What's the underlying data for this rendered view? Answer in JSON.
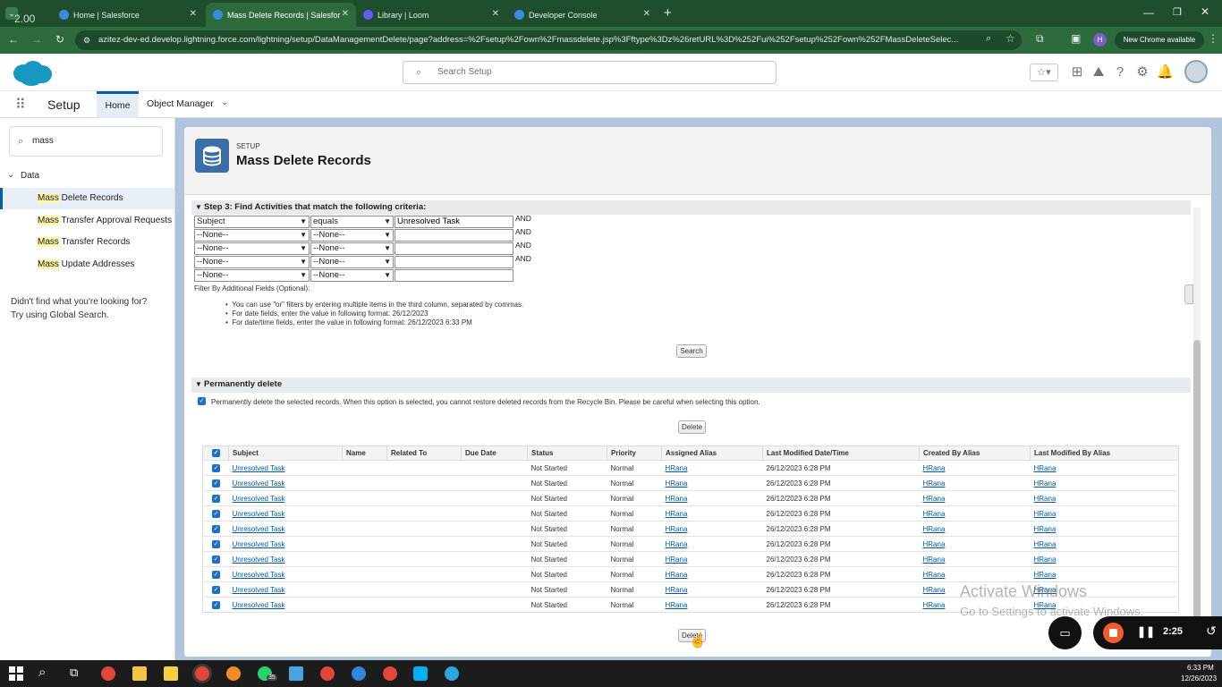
{
  "browser": {
    "overlay_text": "2.00",
    "tabs": [
      {
        "title": "Home | Salesforce",
        "color": "#3a8be0"
      },
      {
        "title": "Mass Delete Records | Salesfor",
        "color": "#3a8be0"
      },
      {
        "title": "Library | Loom",
        "color": "#625df5"
      },
      {
        "title": "Developer Console",
        "color": "#3a8be0"
      }
    ],
    "new_tab": "+",
    "url": "azitez-dev-ed.develop.lightning.force.com/lightning/setup/DataManagementDelete/page?address=%2Fsetup%2Fown%2Fmassdelete.jsp%3Fftype%3Dz%26retURL%3D%252Fui%252Fsetup%252Fown%252FMassDeleteSelec...",
    "profile_initial": "H",
    "update_label": "New Chrome available"
  },
  "sf_header": {
    "search_placeholder": "Search Setup"
  },
  "setup_nav": {
    "app_label": "Setup",
    "tabs": [
      "Home",
      "Object Manager"
    ]
  },
  "sidebar": {
    "search_value": "mass",
    "group": "Data",
    "items": [
      {
        "highlight": "Mass",
        "rest": " Delete Records"
      },
      {
        "highlight": "Mass",
        "rest": " Transfer Approval Requests"
      },
      {
        "highlight": "Mass",
        "rest": " Transfer Records"
      },
      {
        "highlight": "Mass",
        "rest": " Update Addresses"
      }
    ],
    "not_found_1": "Didn't find what you're looking for?",
    "not_found_2": "Try using Global Search."
  },
  "page": {
    "eyebrow": "SETUP",
    "title": "Mass Delete Records"
  },
  "step3": {
    "heading": "Step 3: Find Activities that match the following criteria:",
    "rows": [
      {
        "field": "Subject",
        "operator": "equals",
        "value": "Unresolved Task",
        "conj": "AND"
      },
      {
        "field": "--None--",
        "operator": "--None--",
        "value": "",
        "conj": "AND"
      },
      {
        "field": "--None--",
        "operator": "--None--",
        "value": "",
        "conj": "AND"
      },
      {
        "field": "--None--",
        "operator": "--None--",
        "value": "",
        "conj": "AND"
      },
      {
        "field": "--None--",
        "operator": "--None--",
        "value": "",
        "conj": ""
      }
    ],
    "filter_label": "Filter By Additional Fields (Optional):",
    "hints": [
      "You can use \"or\" filters by entering multiple items in the third column, separated by commas.",
      "For date fields, enter the value in following format: 26/12/2023",
      "For date/time fields, enter the value in following format: 26/12/2023 6:33 PM"
    ],
    "search_button": "Search"
  },
  "perm_delete": {
    "heading": "Permanently delete",
    "checkbox_text": "Permanently delete the selected records. When this option is selected, you cannot restore deleted records from the Recycle Bin. Please be careful when selecting this option.",
    "delete_button": "Delete"
  },
  "results": {
    "columns": [
      "Subject",
      "Name",
      "Related To",
      "Due Date",
      "Status",
      "Priority",
      "Assigned Alias",
      "Last Modified Date/Time",
      "Created By Alias",
      "Last Modified By Alias"
    ],
    "rows": [
      [
        "Unresolved Task",
        "",
        "",
        "",
        "Not Started",
        "Normal",
        "HRana",
        "26/12/2023 6:28 PM",
        "HRana",
        "HRana"
      ],
      [
        "Unresolved Task",
        "",
        "",
        "",
        "Not Started",
        "Normal",
        "HRana",
        "26/12/2023 6:28 PM",
        "HRana",
        "HRana"
      ],
      [
        "Unresolved Task",
        "",
        "",
        "",
        "Not Started",
        "Normal",
        "HRana",
        "26/12/2023 6:28 PM",
        "HRana",
        "HRana"
      ],
      [
        "Unresolved Task",
        "",
        "",
        "",
        "Not Started",
        "Normal",
        "HRana",
        "26/12/2023 6:28 PM",
        "HRana",
        "HRana"
      ],
      [
        "Unresolved Task",
        "",
        "",
        "",
        "Not Started",
        "Normal",
        "HRana",
        "26/12/2023 6:28 PM",
        "HRana",
        "HRana"
      ],
      [
        "Unresolved Task",
        "",
        "",
        "",
        "Not Started",
        "Normal",
        "HRana",
        "26/12/2023 6:28 PM",
        "HRana",
        "HRana"
      ],
      [
        "Unresolved Task",
        "",
        "",
        "",
        "Not Started",
        "Normal",
        "HRana",
        "26/12/2023 6:28 PM",
        "HRana",
        "HRana"
      ],
      [
        "Unresolved Task",
        "",
        "",
        "",
        "Not Started",
        "Normal",
        "HRana",
        "26/12/2023 6:28 PM",
        "HRana",
        "HRana"
      ],
      [
        "Unresolved Task",
        "",
        "",
        "",
        "Not Started",
        "Normal",
        "HRana",
        "26/12/2023 6:28 PM",
        "HRana",
        "HRana"
      ],
      [
        "Unresolved Task",
        "",
        "",
        "",
        "Not Started",
        "Normal",
        "HRana",
        "26/12/2023 6:28 PM",
        "HRana",
        "HRana"
      ]
    ],
    "delete_button": "Delete"
  },
  "watermark": {
    "line1": "Activate Windows",
    "line2": "Go to Settings to activate Windows."
  },
  "recorder": {
    "time": "2:25"
  },
  "taskbar": {
    "time": "6:33 PM",
    "date": "12/26/2023",
    "badge": "35"
  }
}
